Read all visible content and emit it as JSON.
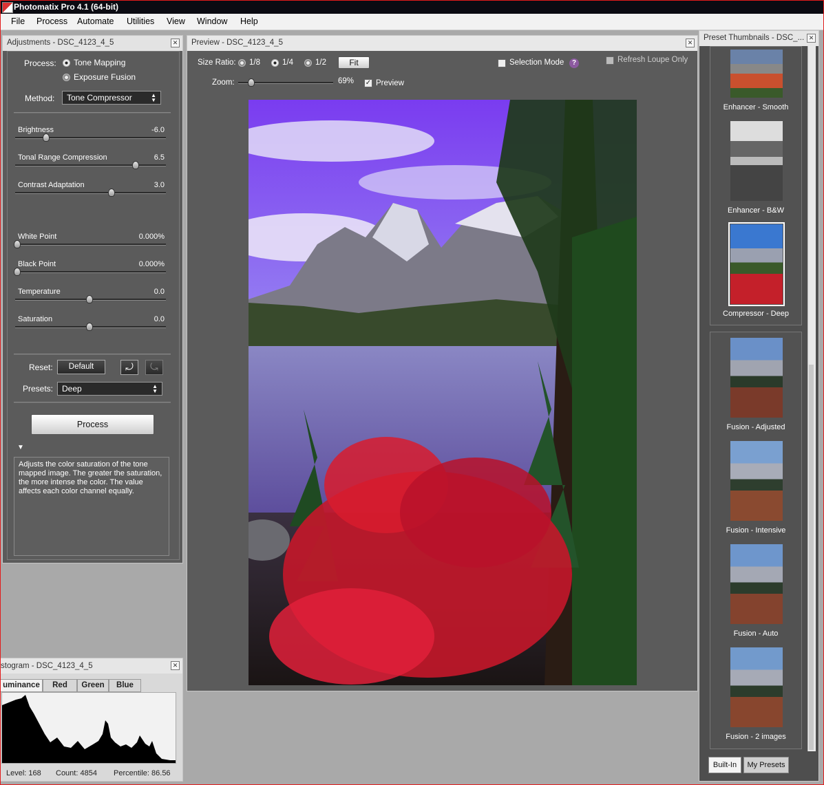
{
  "app": {
    "title": "Photomatix Pro 4.1 (64-bit)",
    "menu": [
      "File",
      "Process",
      "Automate",
      "Utilities",
      "View",
      "Window",
      "Help"
    ]
  },
  "adjustments": {
    "panel_title": "Adjustments - DSC_4123_4_5",
    "process_label": "Process:",
    "process_options": [
      "Tone Mapping",
      "Exposure Fusion"
    ],
    "process_selected": "Tone Mapping",
    "method_label": "Method:",
    "method_value": "Tone Compressor",
    "sliders": [
      {
        "label": "Brightness",
        "value": "-6.0",
        "position": 0.2
      },
      {
        "label": "Tonal Range Compression",
        "value": "6.5",
        "position": 0.82
      },
      {
        "label": "Contrast Adaptation",
        "value": "3.0",
        "position": 0.65
      },
      {
        "label": "White Point",
        "value": "0.000%",
        "position": 0.0
      },
      {
        "label": "Black Point",
        "value": "0.000%",
        "position": 0.0
      },
      {
        "label": "Temperature",
        "value": "0.0",
        "position": 0.5
      },
      {
        "label": "Saturation",
        "value": "0.0",
        "position": 0.5
      }
    ],
    "reset_label": "Reset:",
    "default_button": "Default",
    "presets_label": "Presets:",
    "presets_value": "Deep",
    "process_button": "Process",
    "help_text": "Adjusts the color saturation of the tone mapped image. The greater the saturation, the more intense the color. The value affects each color channel equally."
  },
  "preview": {
    "panel_title": "Preview - DSC_4123_4_5",
    "size_ratio_label": "Size Ratio:",
    "size_ratios": [
      "1/8",
      "1/4",
      "1/2"
    ],
    "size_ratio_selected": "1/4",
    "fit_button": "Fit",
    "zoom_label": "Zoom:",
    "zoom_value": "69%",
    "preview_checkbox": "Preview",
    "selection_mode": "Selection Mode",
    "refresh_loupe": "Refresh Loupe Only",
    "help_icon": "?"
  },
  "presets_panel": {
    "panel_title": "Preset Thumbnails - DSC_...",
    "builtin_top": [
      "Enhancer - Smooth",
      "Enhancer - B&W",
      "Compressor - Deep"
    ],
    "selected": "Compressor - Deep",
    "builtin_bottom": [
      "Fusion - Adjusted",
      "Fusion - Intensive",
      "Fusion - Auto",
      "Fusion - 2 images"
    ],
    "tabs": [
      "Built-In",
      "My Presets"
    ]
  },
  "histogram": {
    "panel_title": "stogram - DSC_4123_4_5",
    "tabs": [
      "uminance",
      "Red",
      "Green",
      "Blue"
    ],
    "active_tab": "uminance",
    "level": "Level: 168",
    "count": "Count: 4854",
    "percentile": "Percentile: 86.56"
  }
}
